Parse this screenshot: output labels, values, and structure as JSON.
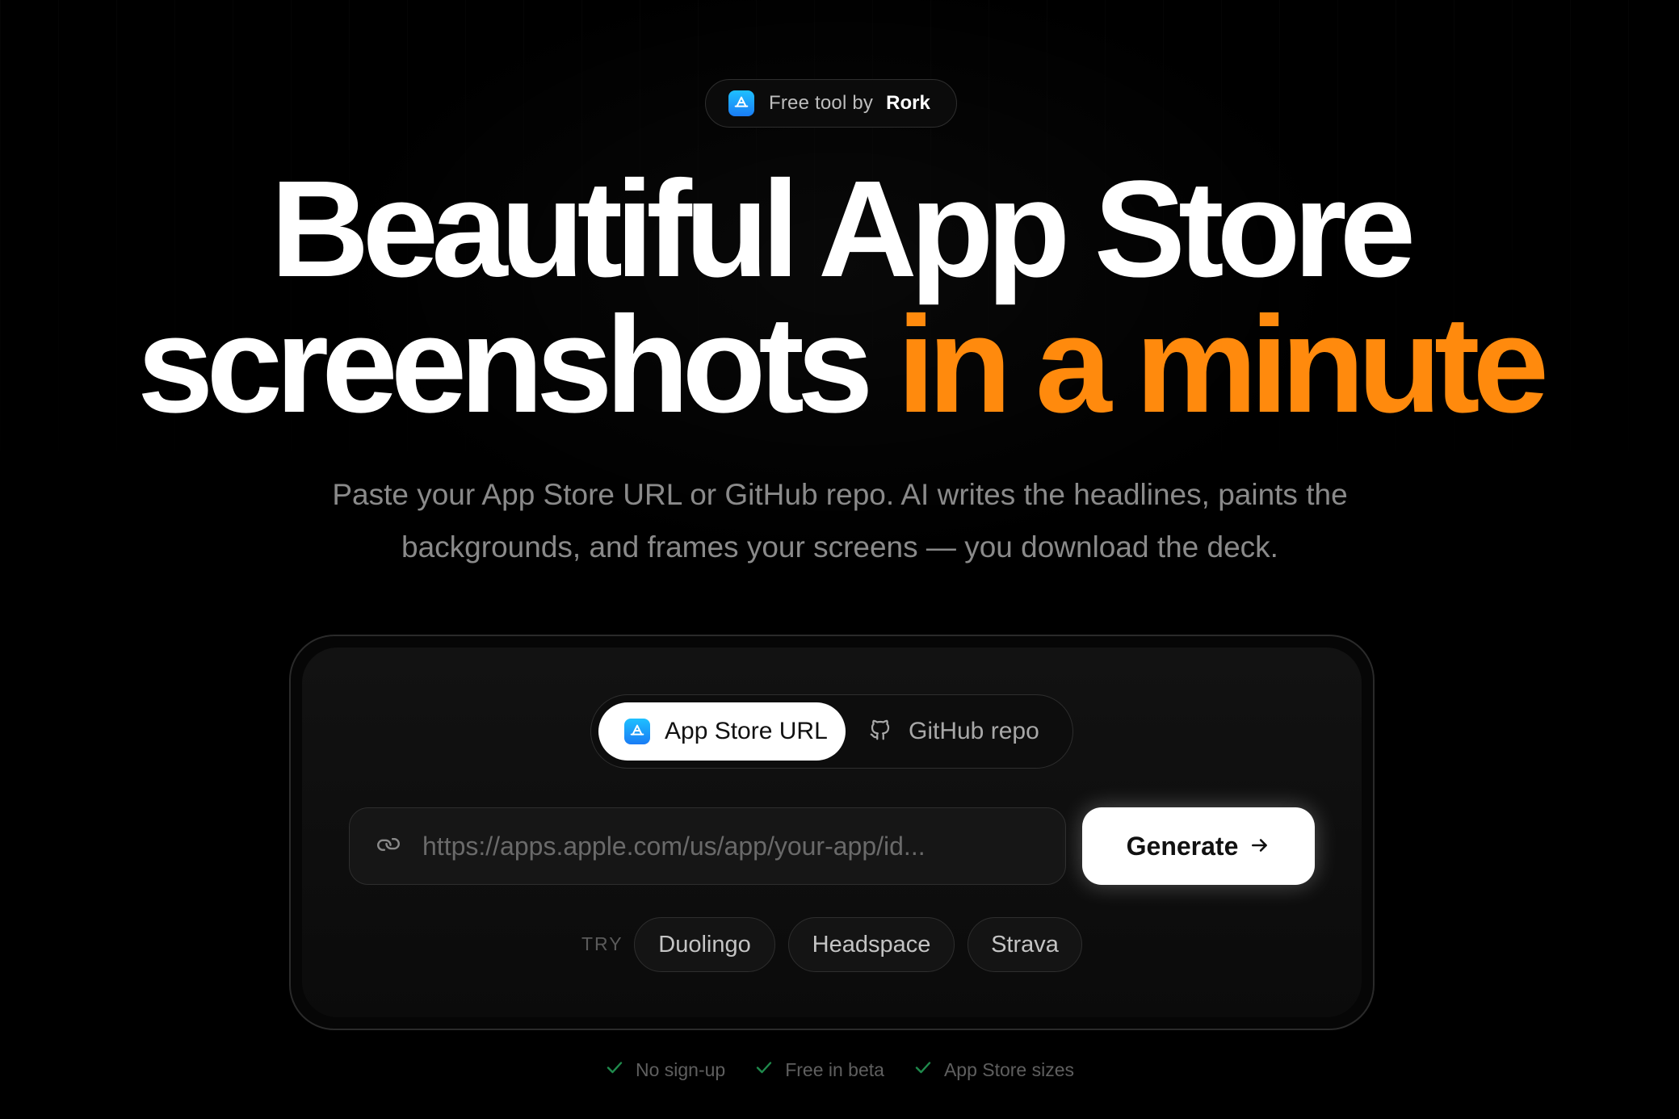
{
  "badge": {
    "prefix": "Free tool by",
    "brand": "Rork",
    "icon": "app-store-icon"
  },
  "hero": {
    "headline_line1": "Beautiful App Store",
    "headline_line2_plain": "screenshots",
    "headline_line2_accent": "in a minute",
    "subtitle_line1": "Paste your App Store URL or GitHub repo. AI writes the headlines, paints the",
    "subtitle_line2": "backgrounds, and frames your screens — you download the deck."
  },
  "tabs": [
    {
      "label": "App Store URL",
      "icon": "app-store-icon",
      "active": true
    },
    {
      "label": "GitHub repo",
      "icon": "github-icon",
      "active": false
    }
  ],
  "url_input": {
    "placeholder": "https://apps.apple.com/us/app/your-app/id...",
    "value": "",
    "icon": "link-icon"
  },
  "generate_button": {
    "label": "Generate",
    "icon": "arrow-right-icon"
  },
  "try": {
    "label": "TRY",
    "chips": [
      "Duolingo",
      "Headspace",
      "Strava"
    ]
  },
  "features": [
    "No sign-up",
    "Free in beta",
    "App Store sizes"
  ],
  "colors": {
    "background": "#000000",
    "accent": "#ff8a0d",
    "check": "#1f8a4c",
    "app_store_blue": "#1a7cf5"
  }
}
